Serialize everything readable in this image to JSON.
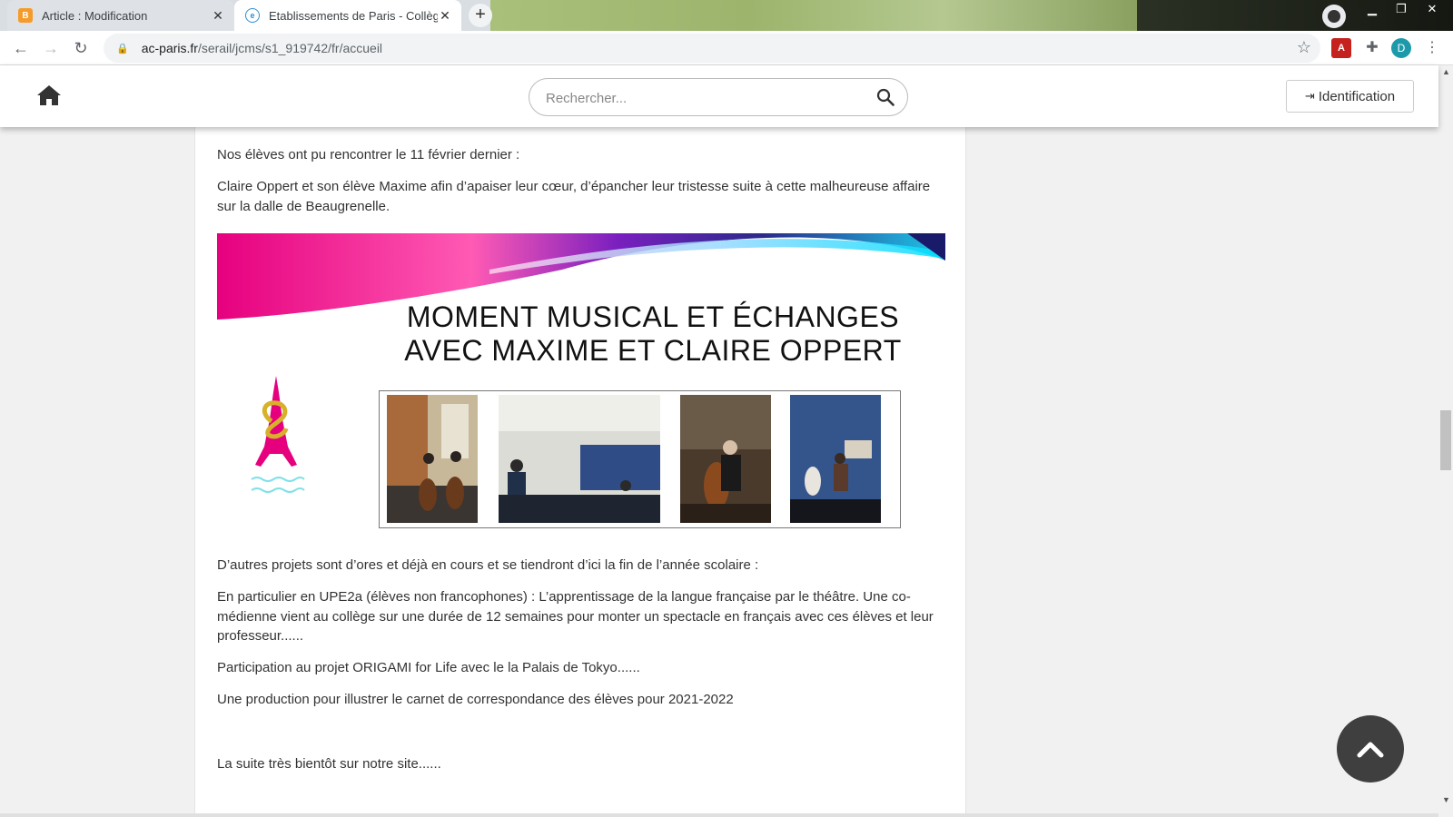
{
  "browser": {
    "tabs": [
      {
        "title": "Article : Modification",
        "favicon": "blogger-icon"
      },
      {
        "title": "Etablissements de Paris - Collège",
        "favicon": "ac-paris-icon"
      }
    ],
    "new_tab_label": "+",
    "address": {
      "domain": "ac-paris.fr",
      "path": "/serail/jcms/s1_919742/fr/accueil"
    },
    "profile_initial": "D",
    "pdf_label": "A"
  },
  "header": {
    "search_placeholder": "Rechercher...",
    "login_label": "Identification"
  },
  "article": {
    "p1": "Nos élèves ont pu rencontrer le 11 février dernier :",
    "p2": "Claire Oppert et son élève Maxime afin d’apaiser leur cœur, d’épancher leur tristesse suite à cette malheureuse af­faire sur la dalle de Beaugrenelle.",
    "banner_title_line1": "MOMENT MUSICAL ET ÉCHANGES",
    "banner_title_line2": "AVEC MAXIME ET CLAIRE OPPERT",
    "p3": "D’autres projets sont d’ores et déjà en cours et se tiendront d’ici la fin de l’année scolaire :",
    "p4": "En particulier en UPE2a (élèves non francophones) : L’apprentissage de la langue française par le théâtre. Une co­médienne vient au collège sur une durée de 12 semaines pour monter un spectacle en français avec ces élèves et leur professeur......",
    "p5": "Participation au projet ORIGAMI for Life avec le la Palais de Tokyo......",
    "p6": "Une production pour illustrer le carnet de correspondance des élèves pour 2021-2022",
    "p7": "La suite très bientôt sur notre site......"
  },
  "colors": {
    "accent_pink": "#e6007e",
    "back_to_top": "#3f3f3f"
  }
}
